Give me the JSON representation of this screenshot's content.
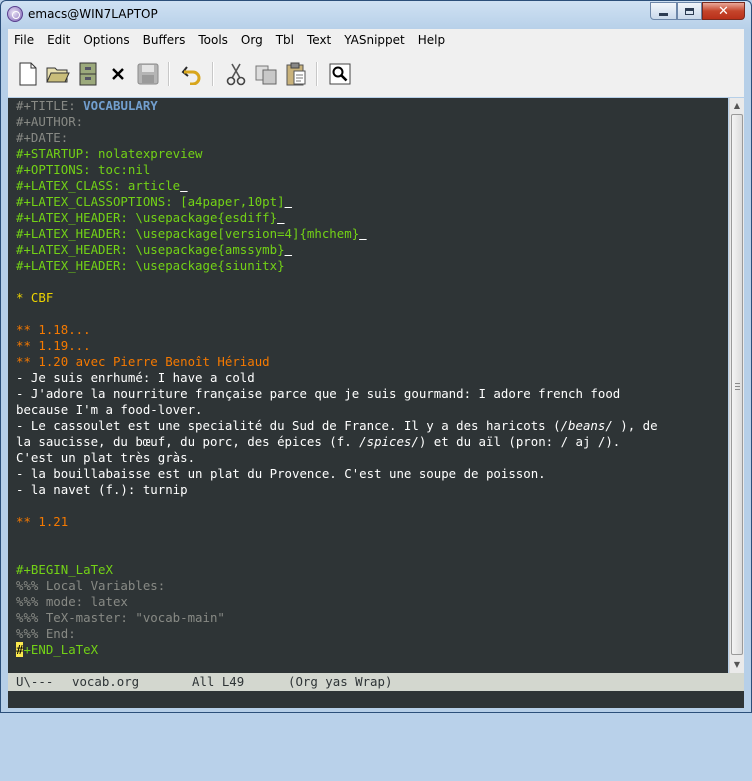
{
  "window": {
    "title": "emacs@WIN7LAPTOP"
  },
  "menu": [
    "File",
    "Edit",
    "Options",
    "Buffers",
    "Tools",
    "Org",
    "Tbl",
    "Text",
    "YASnippet",
    "Help"
  ],
  "toolbar": {
    "buttons": [
      "new-file",
      "open-folder",
      "dired",
      "close-buffer",
      "save",
      "undo",
      "cut",
      "copy",
      "paste",
      "search"
    ]
  },
  "buffer": {
    "lines": [
      [
        {
          "t": "#+TITLE: ",
          "c": "meta"
        },
        {
          "t": "VOCABULARY",
          "c": "title-val"
        }
      ],
      [
        {
          "t": "#+AUTHOR:",
          "c": "meta"
        }
      ],
      [
        {
          "t": "#+DATE:",
          "c": "meta"
        }
      ],
      [
        {
          "t": "#+STARTUP: nolatexpreview",
          "c": "kw"
        }
      ],
      [
        {
          "t": "#+OPTIONS: toc:nil",
          "c": "kw"
        }
      ],
      [
        {
          "t": "#+LATEX_CLASS: article",
          "c": "kw"
        },
        {
          "t": " ",
          "c": "uline"
        }
      ],
      [
        {
          "t": "#+LATEX_CLASSOPTIONS: [a4paper,10pt]",
          "c": "kw"
        },
        {
          "t": " ",
          "c": "uline"
        }
      ],
      [
        {
          "t": "#+LATEX_HEADER: \\usepackage{esdiff}",
          "c": "kw"
        },
        {
          "t": " ",
          "c": "uline"
        }
      ],
      [
        {
          "t": "#+LATEX_HEADER: \\usepackage[version=4]{mhchem}",
          "c": "kw"
        },
        {
          "t": " ",
          "c": "uline"
        }
      ],
      [
        {
          "t": "#+LATEX_HEADER: \\usepackage{amssymb}",
          "c": "kw"
        },
        {
          "t": " ",
          "c": "uline"
        }
      ],
      [
        {
          "t": "#+LATEX_HEADER: \\usepackage{siunitx}",
          "c": "kw"
        }
      ],
      [],
      [
        {
          "t": "* CBF",
          "c": "h1"
        }
      ],
      [],
      [
        {
          "t": "** 1.18...",
          "c": "h2"
        }
      ],
      [
        {
          "t": "** 1.19...",
          "c": "h2"
        }
      ],
      [
        {
          "t": "** 1.20 avec Pierre Benoît Hériaud",
          "c": "h2"
        }
      ],
      [
        {
          "t": "- Je suis enrhumé: I have a cold",
          "c": ""
        }
      ],
      [
        {
          "t": "- J'adore la nourriture française parce que je suis gourmand: I adore french food",
          "c": ""
        }
      ],
      [
        {
          "t": "because I'm a food-lover.",
          "c": ""
        }
      ],
      [
        {
          "t": "- Le cassoulet est une specialité du Sud de France. Il y a des haricots (",
          "c": ""
        },
        {
          "t": "/beans/",
          "c": "em"
        },
        {
          "t": " ), de",
          "c": ""
        }
      ],
      [
        {
          "t": "la saucisse, du bœuf, du porc, des épices (f. ",
          "c": ""
        },
        {
          "t": "/spices/",
          "c": "em"
        },
        {
          "t": ") et du aïl (pron: / aj /).",
          "c": ""
        }
      ],
      [
        {
          "t": "C'est un plat très gràs.",
          "c": ""
        }
      ],
      [
        {
          "t": "- la bouillabaisse est un plat du Provence. C'est une soupe de poisson.",
          "c": ""
        }
      ],
      [
        {
          "t": "- la navet (f.): turnip",
          "c": ""
        }
      ],
      [],
      [
        {
          "t": "** 1.21",
          "c": "h2"
        }
      ],
      [],
      [],
      [
        {
          "t": "#+BEGIN_LaTeX",
          "c": "kw"
        }
      ],
      [
        {
          "t": "%%% Local Variables:",
          "c": "meta"
        }
      ],
      [
        {
          "t": "%%% mode: latex",
          "c": "meta"
        }
      ],
      [
        {
          "t": "%%% TeX-master: \"vocab-main\"",
          "c": "meta"
        }
      ],
      [
        {
          "t": "%%% End:",
          "c": "meta"
        }
      ],
      [
        {
          "t": "#",
          "c": "cursor"
        },
        {
          "t": "+END_LaTeX",
          "c": "kw"
        }
      ]
    ]
  },
  "modeline": {
    "status": "U\\---",
    "buffer_name": "vocab.org",
    "position": "All L49",
    "modes": "(Org yas Wrap)"
  }
}
